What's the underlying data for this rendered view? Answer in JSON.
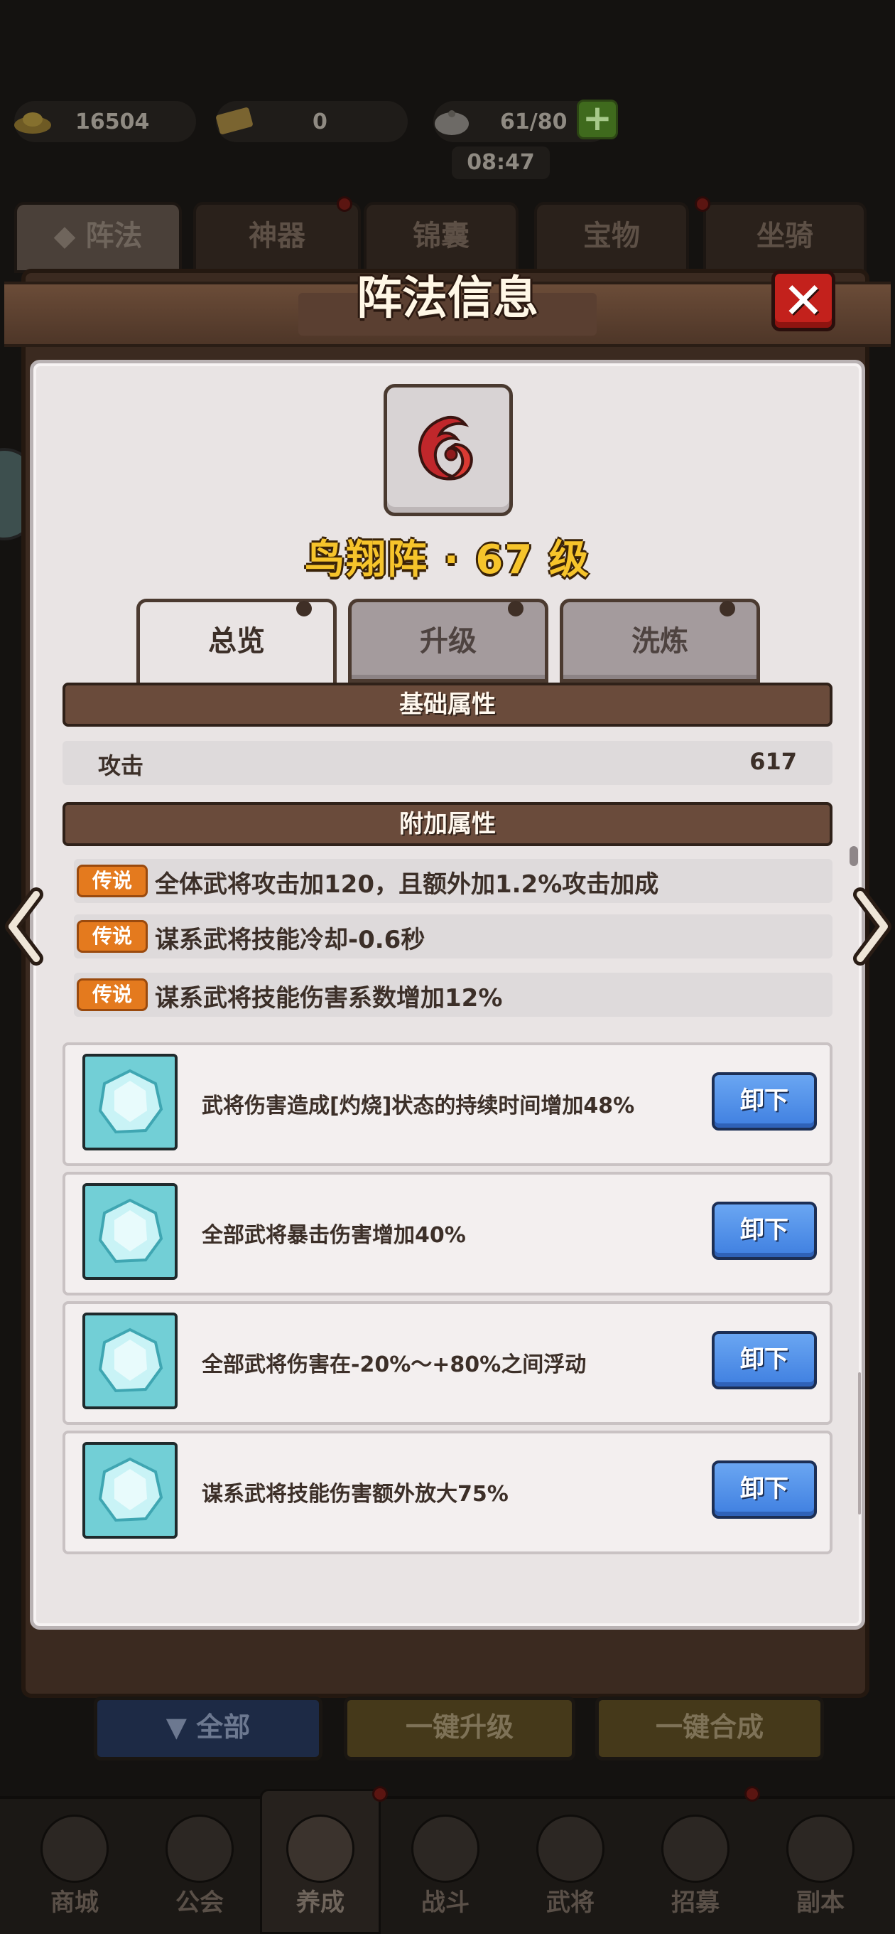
{
  "resources": {
    "gold": "16504",
    "ticket": "0",
    "stamina": "61/80",
    "timer": "08:47"
  },
  "category_tabs": [
    "阵法",
    "神器",
    "锦囊",
    "宝物",
    "坐骑"
  ],
  "modal": {
    "title": "阵法信息",
    "formation_name": "鸟翔阵 · 67 级",
    "sub_tabs": [
      "总览",
      "升级",
      "洗炼"
    ],
    "base_section_title": "基础属性",
    "base_stats": [
      {
        "name": "攻击",
        "value": "617"
      }
    ],
    "extra_section_title": "附加属性",
    "extra_stats": [
      {
        "badge": "传说",
        "text": "全体武将攻击加120，且额外加1.2%攻击加成"
      },
      {
        "badge": "传说",
        "text": "谋系武将技能冷却-0.6秒"
      },
      {
        "badge": "传说",
        "text": "谋系武将技能伤害系数增加12%"
      }
    ],
    "gems": [
      {
        "text": "武将伤害造成[灼烧]状态的持续时间增加48%",
        "button": "卸下"
      },
      {
        "text": "全部武将暴击伤害增加40%",
        "button": "卸下"
      },
      {
        "text": "全部武将伤害在-20%～+80%之间浮动",
        "button": "卸下"
      },
      {
        "text": "谋系武将技能伤害额外放大75%",
        "button": "卸下"
      }
    ]
  },
  "actions": {
    "filter_all": "全部",
    "upgrade_all": "一键升级",
    "merge_all": "一键合成"
  },
  "bottom_nav": [
    "商城",
    "公会",
    "养成",
    "战斗",
    "武将",
    "招募",
    "副本"
  ],
  "colors": {
    "legend_badge": "#e47a1e",
    "title_gold": "#f6c42b",
    "unequip_blue": "#4f8ee8",
    "close_red": "#c3211c"
  }
}
